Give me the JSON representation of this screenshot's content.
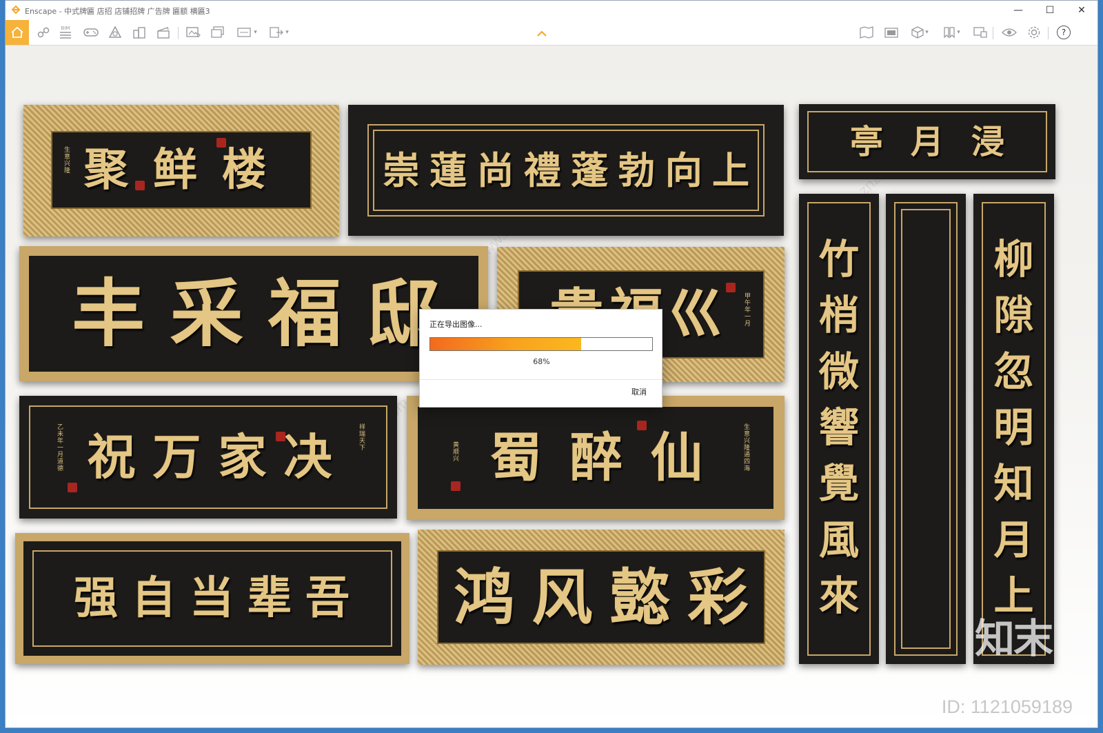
{
  "window": {
    "title": "Enscape - 中式牌匾 店招 店铺招牌 广告牌 匾额 横匾3",
    "minimize_glyph": "—",
    "maximize_glyph": "☐",
    "close_glyph": "✕"
  },
  "toolbar": {
    "left_tools": [
      "home-icon",
      "link-icon",
      "bim-icon",
      "gamepad-icon",
      "asset-library-icon",
      "building-icon",
      "clapper-icon",
      "screenshot-icon",
      "batch-render-icon",
      "panorama-icon",
      "export-exe-icon"
    ],
    "right_tools": [
      "sun-map-icon",
      "camera-view-icon",
      "cube-view-icon",
      "bookmark-icon",
      "shield-view-icon",
      "visibility-icon",
      "settings-icon",
      "help-icon"
    ],
    "bim_label": "BIM",
    "help_glyph": "?"
  },
  "signs": {
    "s1": {
      "chars": [
        "聚",
        "鲜",
        "楼"
      ],
      "small": "生意兴隆"
    },
    "s2": {
      "chars": [
        "崇",
        "蓮",
        "尚",
        "禮",
        "蓬",
        "勃",
        "向",
        "上"
      ]
    },
    "s3": {
      "chars": [
        "亭",
        "月",
        "浸"
      ]
    },
    "s4": {
      "chars": [
        "丰",
        "采",
        "福",
        "邸"
      ]
    },
    "s5": {
      "chars": [
        "貴",
        "福",
        "巛"
      ],
      "small": "甲午年一月"
    },
    "s6": {
      "chars": [
        "祝",
        "万",
        "家",
        "决"
      ],
      "small_left": "乙未年一月道德",
      "small_right": "祥瑞天下"
    },
    "s7": {
      "chars": [
        "蜀",
        "醉",
        "仙"
      ],
      "small_left": "黄顺兴",
      "small_right": "生意兴隆通四海"
    },
    "s8": {
      "chars": [
        "强",
        "自",
        "当",
        "辈",
        "吾"
      ]
    },
    "s9": {
      "chars": [
        "鸿",
        "风",
        "懿",
        "彩"
      ]
    },
    "v1": {
      "chars": [
        "竹",
        "梢",
        "微",
        "響",
        "覺",
        "風",
        "來"
      ]
    },
    "v2": {
      "chars": []
    },
    "v3": {
      "chars": [
        "柳",
        "隙",
        "忽",
        "明",
        "知",
        "月",
        "上"
      ]
    }
  },
  "dialog": {
    "title": "正在导出图像...",
    "progress": 0.68,
    "progress_text": "68%",
    "cancel_label": "取消"
  },
  "watermark": {
    "logo_text": "知末",
    "id_text": "ID: 1121059189",
    "site_text": "www.znzmo.com"
  },
  "colors": {
    "accent": "#f6b23a",
    "gold": "#e4c685",
    "panel": "#1e1d1b",
    "progress_start": "#f26a1e",
    "progress_end": "#fbb81e"
  }
}
